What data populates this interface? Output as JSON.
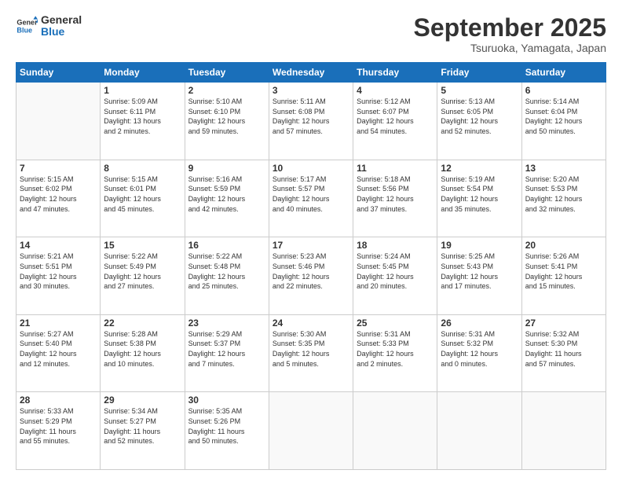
{
  "logo": {
    "line1": "General",
    "line2": "Blue"
  },
  "title": "September 2025",
  "subtitle": "Tsuruoka, Yamagata, Japan",
  "days_of_week": [
    "Sunday",
    "Monday",
    "Tuesday",
    "Wednesday",
    "Thursday",
    "Friday",
    "Saturday"
  ],
  "weeks": [
    [
      {
        "day": "",
        "info": ""
      },
      {
        "day": "1",
        "info": "Sunrise: 5:09 AM\nSunset: 6:11 PM\nDaylight: 13 hours\nand 2 minutes."
      },
      {
        "day": "2",
        "info": "Sunrise: 5:10 AM\nSunset: 6:10 PM\nDaylight: 12 hours\nand 59 minutes."
      },
      {
        "day": "3",
        "info": "Sunrise: 5:11 AM\nSunset: 6:08 PM\nDaylight: 12 hours\nand 57 minutes."
      },
      {
        "day": "4",
        "info": "Sunrise: 5:12 AM\nSunset: 6:07 PM\nDaylight: 12 hours\nand 54 minutes."
      },
      {
        "day": "5",
        "info": "Sunrise: 5:13 AM\nSunset: 6:05 PM\nDaylight: 12 hours\nand 52 minutes."
      },
      {
        "day": "6",
        "info": "Sunrise: 5:14 AM\nSunset: 6:04 PM\nDaylight: 12 hours\nand 50 minutes."
      }
    ],
    [
      {
        "day": "7",
        "info": "Sunrise: 5:15 AM\nSunset: 6:02 PM\nDaylight: 12 hours\nand 47 minutes."
      },
      {
        "day": "8",
        "info": "Sunrise: 5:15 AM\nSunset: 6:01 PM\nDaylight: 12 hours\nand 45 minutes."
      },
      {
        "day": "9",
        "info": "Sunrise: 5:16 AM\nSunset: 5:59 PM\nDaylight: 12 hours\nand 42 minutes."
      },
      {
        "day": "10",
        "info": "Sunrise: 5:17 AM\nSunset: 5:57 PM\nDaylight: 12 hours\nand 40 minutes."
      },
      {
        "day": "11",
        "info": "Sunrise: 5:18 AM\nSunset: 5:56 PM\nDaylight: 12 hours\nand 37 minutes."
      },
      {
        "day": "12",
        "info": "Sunrise: 5:19 AM\nSunset: 5:54 PM\nDaylight: 12 hours\nand 35 minutes."
      },
      {
        "day": "13",
        "info": "Sunrise: 5:20 AM\nSunset: 5:53 PM\nDaylight: 12 hours\nand 32 minutes."
      }
    ],
    [
      {
        "day": "14",
        "info": "Sunrise: 5:21 AM\nSunset: 5:51 PM\nDaylight: 12 hours\nand 30 minutes."
      },
      {
        "day": "15",
        "info": "Sunrise: 5:22 AM\nSunset: 5:49 PM\nDaylight: 12 hours\nand 27 minutes."
      },
      {
        "day": "16",
        "info": "Sunrise: 5:22 AM\nSunset: 5:48 PM\nDaylight: 12 hours\nand 25 minutes."
      },
      {
        "day": "17",
        "info": "Sunrise: 5:23 AM\nSunset: 5:46 PM\nDaylight: 12 hours\nand 22 minutes."
      },
      {
        "day": "18",
        "info": "Sunrise: 5:24 AM\nSunset: 5:45 PM\nDaylight: 12 hours\nand 20 minutes."
      },
      {
        "day": "19",
        "info": "Sunrise: 5:25 AM\nSunset: 5:43 PM\nDaylight: 12 hours\nand 17 minutes."
      },
      {
        "day": "20",
        "info": "Sunrise: 5:26 AM\nSunset: 5:41 PM\nDaylight: 12 hours\nand 15 minutes."
      }
    ],
    [
      {
        "day": "21",
        "info": "Sunrise: 5:27 AM\nSunset: 5:40 PM\nDaylight: 12 hours\nand 12 minutes."
      },
      {
        "day": "22",
        "info": "Sunrise: 5:28 AM\nSunset: 5:38 PM\nDaylight: 12 hours\nand 10 minutes."
      },
      {
        "day": "23",
        "info": "Sunrise: 5:29 AM\nSunset: 5:37 PM\nDaylight: 12 hours\nand 7 minutes."
      },
      {
        "day": "24",
        "info": "Sunrise: 5:30 AM\nSunset: 5:35 PM\nDaylight: 12 hours\nand 5 minutes."
      },
      {
        "day": "25",
        "info": "Sunrise: 5:31 AM\nSunset: 5:33 PM\nDaylight: 12 hours\nand 2 minutes."
      },
      {
        "day": "26",
        "info": "Sunrise: 5:31 AM\nSunset: 5:32 PM\nDaylight: 12 hours\nand 0 minutes."
      },
      {
        "day": "27",
        "info": "Sunrise: 5:32 AM\nSunset: 5:30 PM\nDaylight: 11 hours\nand 57 minutes."
      }
    ],
    [
      {
        "day": "28",
        "info": "Sunrise: 5:33 AM\nSunset: 5:29 PM\nDaylight: 11 hours\nand 55 minutes."
      },
      {
        "day": "29",
        "info": "Sunrise: 5:34 AM\nSunset: 5:27 PM\nDaylight: 11 hours\nand 52 minutes."
      },
      {
        "day": "30",
        "info": "Sunrise: 5:35 AM\nSunset: 5:26 PM\nDaylight: 11 hours\nand 50 minutes."
      },
      {
        "day": "",
        "info": ""
      },
      {
        "day": "",
        "info": ""
      },
      {
        "day": "",
        "info": ""
      },
      {
        "day": "",
        "info": ""
      }
    ]
  ]
}
